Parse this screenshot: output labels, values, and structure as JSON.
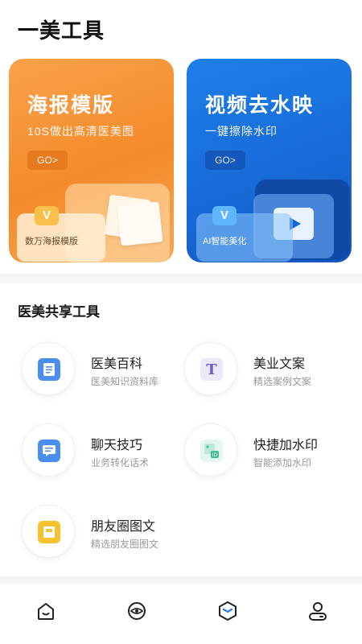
{
  "header": {
    "title": "一美工具"
  },
  "banners": [
    {
      "title": "海报模版",
      "subtitle": "10S做出高清医美图",
      "go": "GO>",
      "tag": "数万海报模版"
    },
    {
      "title": "视频去水映",
      "subtitle": "一键擦除水印",
      "go": "GO>",
      "tag": "AI智能美化"
    }
  ],
  "section": {
    "title": "医美共享工具"
  },
  "tools": [
    {
      "name": "医美百科",
      "desc": "医美知识资料库",
      "icon": "document-icon",
      "color": "#4a8ef0"
    },
    {
      "name": "美业文案",
      "desc": "精选案例文案",
      "icon": "text-t-icon",
      "color": "#7a6cd8"
    },
    {
      "name": "聊天技巧",
      "desc": "业务转化话术",
      "icon": "chat-icon",
      "color": "#4a8ef0"
    },
    {
      "name": "快捷加水印",
      "desc": "智能添加水印",
      "icon": "watermark-icon",
      "color": "#3fbf8f"
    },
    {
      "name": "朋友圈图文",
      "desc": "精选朋友圈图文",
      "icon": "picture-icon",
      "color": "#f5c330"
    }
  ],
  "tabbar": [
    {
      "icon": "home-icon"
    },
    {
      "icon": "discover-icon"
    },
    {
      "icon": "tools-cube-icon"
    },
    {
      "icon": "profile-icon"
    }
  ]
}
